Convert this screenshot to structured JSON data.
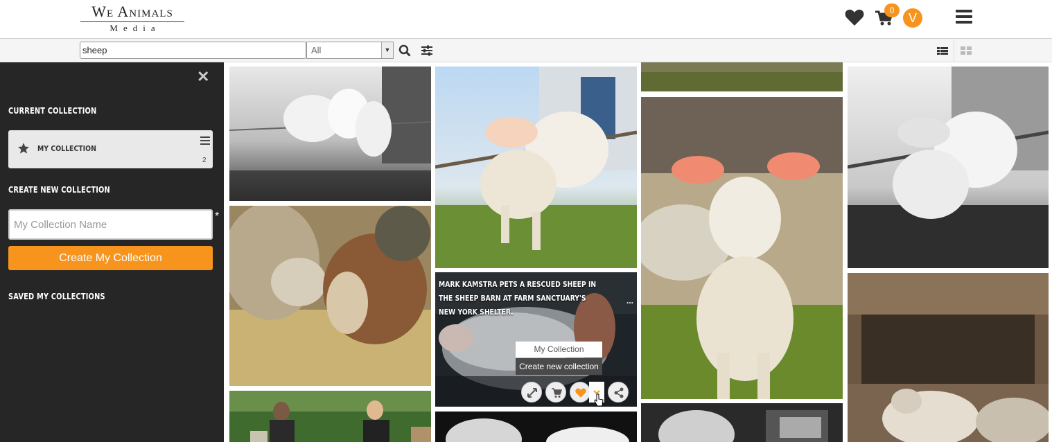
{
  "header": {
    "logo_line1": "We Animals",
    "logo_line2": "Media",
    "cart_count": "0",
    "avatar_initial": "V",
    "icons": [
      "heart-icon",
      "cart-icon",
      "menu-icon"
    ]
  },
  "search": {
    "value": "sheep",
    "category_selected": "All",
    "icons": [
      "search-icon",
      "filter-icon",
      "list-view-icon",
      "grid-view-icon"
    ]
  },
  "sidebar": {
    "current_collection_heading": "Current Collection",
    "current_collection": {
      "name": "My Collection",
      "count": "2"
    },
    "create_heading": "Create New Collection",
    "name_placeholder": "My Collection Name",
    "required_mark": "*",
    "create_button": "Create My Collection",
    "saved_heading": "Saved My Collections"
  },
  "gallery": {
    "hover_caption": "Mark Kamstra pets a rescued sheep in the sheep barn at Farm Sanctuary's New York Shelter.",
    "caption_more": "...",
    "collection_dropdown": {
      "item_existing": "My Collection",
      "item_create": "Create new collection"
    },
    "action_icons": [
      "expand-icon",
      "cart-icon",
      "heart-icon",
      "chevron-down-icon",
      "share-icon"
    ]
  },
  "colors": {
    "accent": "#f7941d",
    "sidebar_bg": "#262626"
  }
}
